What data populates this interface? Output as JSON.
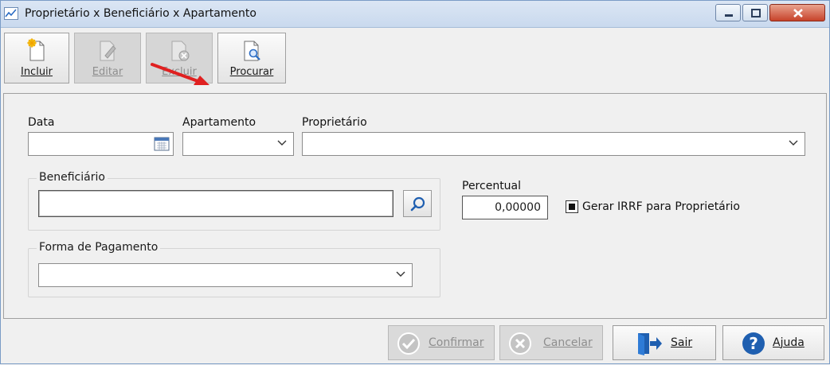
{
  "window": {
    "title": "Proprietário x Beneficiário x Apartamento"
  },
  "toolbar": {
    "incluir": "Incluir",
    "editar": "Editar",
    "excluir": "Excluir",
    "procurar": "Procurar"
  },
  "form": {
    "data_label": "Data",
    "data_value": "",
    "apartamento_label": "Apartamento",
    "apartamento_value": "",
    "proprietario_label": "Proprietário",
    "proprietario_value": "",
    "beneficiario_label": "Beneficiário",
    "beneficiario_value": "",
    "percentual_label": "Percentual",
    "percentual_value": "0,00000",
    "gerar_irrf_label": "Gerar IRRF para Proprietário",
    "gerar_irrf_checked": true,
    "forma_pagamento_label": "Forma de Pagamento",
    "forma_pagamento_value": ""
  },
  "footer": {
    "confirmar": "Confirmar",
    "cancelar": "Cancelar",
    "sair": "Sair",
    "ajuda": "Ajuda"
  },
  "colors": {
    "accent": "#2a6cc4",
    "close": "#c7432a",
    "arrow": "#e02020"
  }
}
